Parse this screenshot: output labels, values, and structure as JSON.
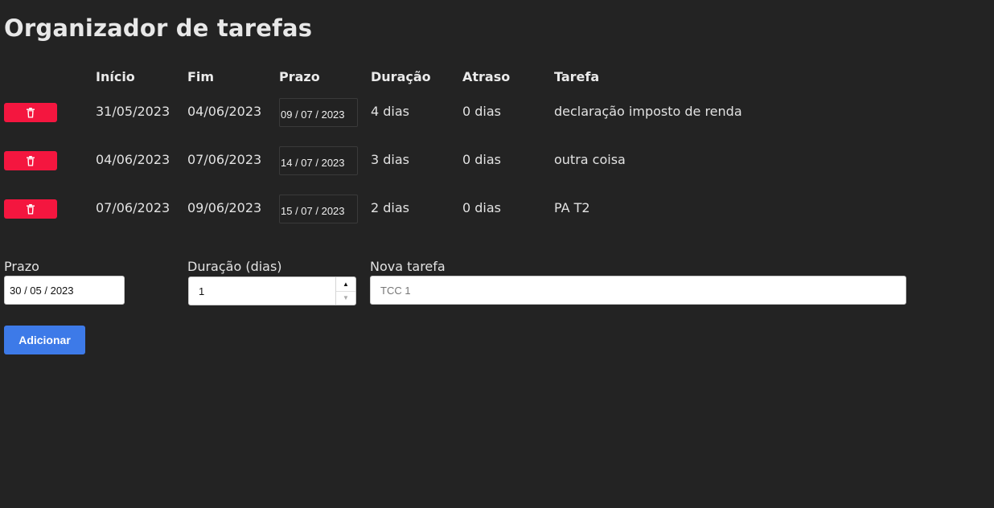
{
  "page": {
    "title": "Organizador de tarefas"
  },
  "table": {
    "headers": [
      "",
      "Início",
      "Fim",
      "Prazo",
      "Duração",
      "Atraso",
      "Tarefa"
    ],
    "rows": [
      {
        "inicio": "31/05/2023",
        "fim": "04/06/2023",
        "prazo": "09 / 07 / 2023",
        "duracao": "4 dias",
        "atraso": "0 dias",
        "tarefa": "declaração imposto de renda"
      },
      {
        "inicio": "04/06/2023",
        "fim": "07/06/2023",
        "prazo": "14 / 07 / 2023",
        "duracao": "3 dias",
        "atraso": "0 dias",
        "tarefa": "outra coisa"
      },
      {
        "inicio": "07/06/2023",
        "fim": "09/06/2023",
        "prazo": "15 / 07 / 2023",
        "duracao": "2 dias",
        "atraso": "0 dias",
        "tarefa": "PA T2"
      }
    ]
  },
  "form": {
    "prazo_label": "Prazo",
    "prazo_value": "30 / 05 / 2023",
    "duracao_label": "Duração (dias)",
    "duracao_value": "1",
    "tarefa_label": "Nova tarefa",
    "tarefa_value": "",
    "tarefa_placeholder": "TCC 1",
    "add_label": "Adicionar"
  },
  "icons": {
    "delete": "trash-icon",
    "stepper_up": "chevron-up-icon",
    "stepper_down": "chevron-down-icon"
  },
  "colors": {
    "background": "#232323",
    "delete_button": "#f4163f",
    "add_button": "#3d7ae8"
  }
}
